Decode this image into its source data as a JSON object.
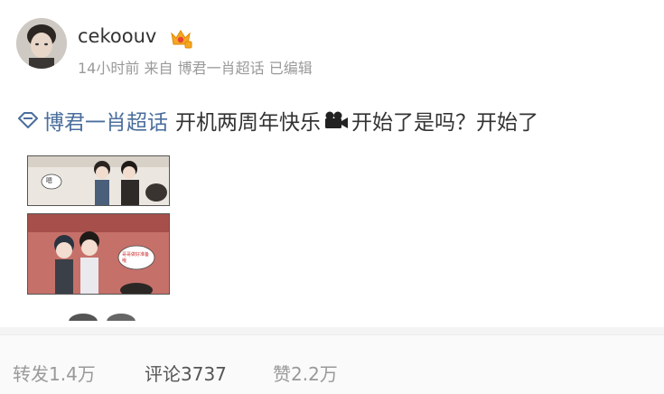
{
  "user": {
    "name": "cekoouv",
    "avatar_icon": "avatar-portrait",
    "badge_icon": "vip-crown-icon"
  },
  "meta": {
    "time": "14小时前",
    "source_prefix": "来自",
    "source": "博君一肖超话",
    "edited": "已编辑"
  },
  "post": {
    "topic": "博君一肖超话",
    "text_before_emoji": "开机两周年快乐",
    "emoji": "movie-camera-icon",
    "text_after_emoji": "开始了是吗？开始了"
  },
  "comic": {
    "panel1_bubble": "嗯",
    "panel2_bubble": "哥哥做好准备哦"
  },
  "actions": {
    "repost": "转发1.4万",
    "comment": "评论3737",
    "like": "赞2.2万"
  },
  "colors": {
    "link": "#4a6e9c",
    "muted": "#9a9a9a",
    "text": "#333333"
  }
}
